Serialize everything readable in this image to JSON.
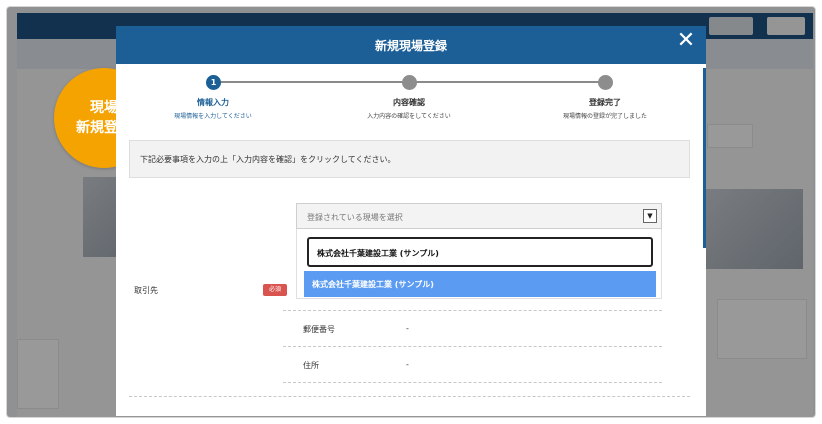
{
  "modal": {
    "title": "新規現場登録",
    "close_icon": "close-icon"
  },
  "badge": {
    "line1": "現場",
    "line2": "新規登録"
  },
  "stepper": {
    "steps": [
      {
        "number": "1",
        "label": "情報入力",
        "sub": "現場情報を入力してください",
        "active": true
      },
      {
        "number": "",
        "label": "内容確認",
        "sub": "入力内容の確認をしてください",
        "active": false
      },
      {
        "number": "",
        "label": "登録完了",
        "sub": "現場情報の登録が完了しました",
        "active": false
      }
    ]
  },
  "notice": "下記必要事項を入力の上「入力内容を確認」をクリックしてください。",
  "form": {
    "client_label": "取引先",
    "required_badge": "必須",
    "select_placeholder": "登録されている現場を選択",
    "search_value": "株式会社千葉建設工業 (サンプル)",
    "option_highlighted": "株式会社千葉建設工業 (サンプル)",
    "postal_label": "郵便番号",
    "postal_value": "-",
    "address_label": "住所",
    "address_value": "-"
  },
  "colors": {
    "header_blue": "#1c5f97",
    "badge_orange": "#f5a300",
    "highlight_blue": "#5b9bf2",
    "required_red": "#d9534f"
  }
}
